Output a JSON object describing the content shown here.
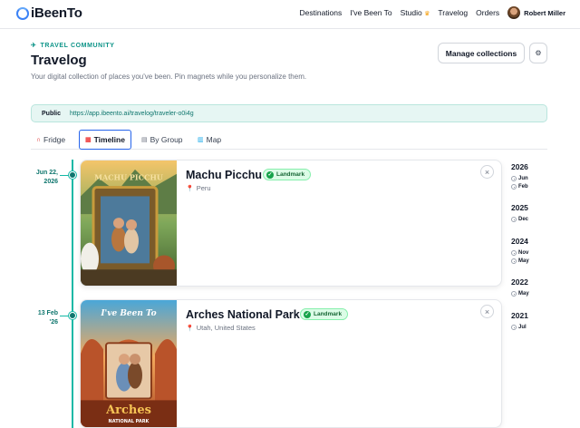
{
  "app": {
    "name": "iBeenTo"
  },
  "nav": {
    "items": [
      "Destinations",
      "I've Been To",
      "Studio",
      "Travelog",
      "Orders"
    ],
    "user_name": "Robert Miller"
  },
  "header": {
    "eyebrow": "TRAVEL COMMUNITY",
    "title": "Travelog",
    "subtitle": "Your digital collection of places you've been. Pin magnets while you personalize them.",
    "manage_label": "Manage collections",
    "settings_icon": "⚙"
  },
  "public": {
    "label": "Public",
    "url": "https://app.ibeento.ai/travelog/traveler-o0i4g"
  },
  "tabs": [
    {
      "label": "Fridge",
      "icon": "magnet-icon",
      "active": false
    },
    {
      "label": "Timeline",
      "icon": "calendar-icon",
      "active": true
    },
    {
      "label": "By Group",
      "icon": "grid-icon",
      "active": false
    },
    {
      "label": "Map",
      "icon": "map-icon",
      "active": false
    }
  ],
  "timeline": [
    {
      "date_line1": "Jun 22,",
      "date_line2": "2026",
      "title": "Machu Picchu",
      "badge": "Landmark",
      "location": "Peru",
      "image_title": "MACHU PICCHU"
    },
    {
      "date_line1": "13 Feb",
      "date_line2": "'26",
      "title": "Arches National Park",
      "badge": "Landmark",
      "location": "Utah, United States",
      "image_title": "I've Been To",
      "image_caption": "Arches",
      "image_subcaption": "NATIONAL PARK"
    }
  ],
  "years": [
    {
      "year": "2026",
      "months": [
        "Jun",
        "Feb"
      ]
    },
    {
      "year": "2025",
      "months": [
        "Dec"
      ]
    },
    {
      "year": "2024",
      "months": [
        "Nov",
        "May"
      ]
    },
    {
      "year": "2022",
      "months": [
        "May"
      ]
    },
    {
      "year": "2021",
      "months": [
        "Jul"
      ]
    }
  ],
  "colors": {
    "accent": "#0d9488",
    "tab_active": "#2563eb",
    "badge_bg": "#dcfce7"
  }
}
